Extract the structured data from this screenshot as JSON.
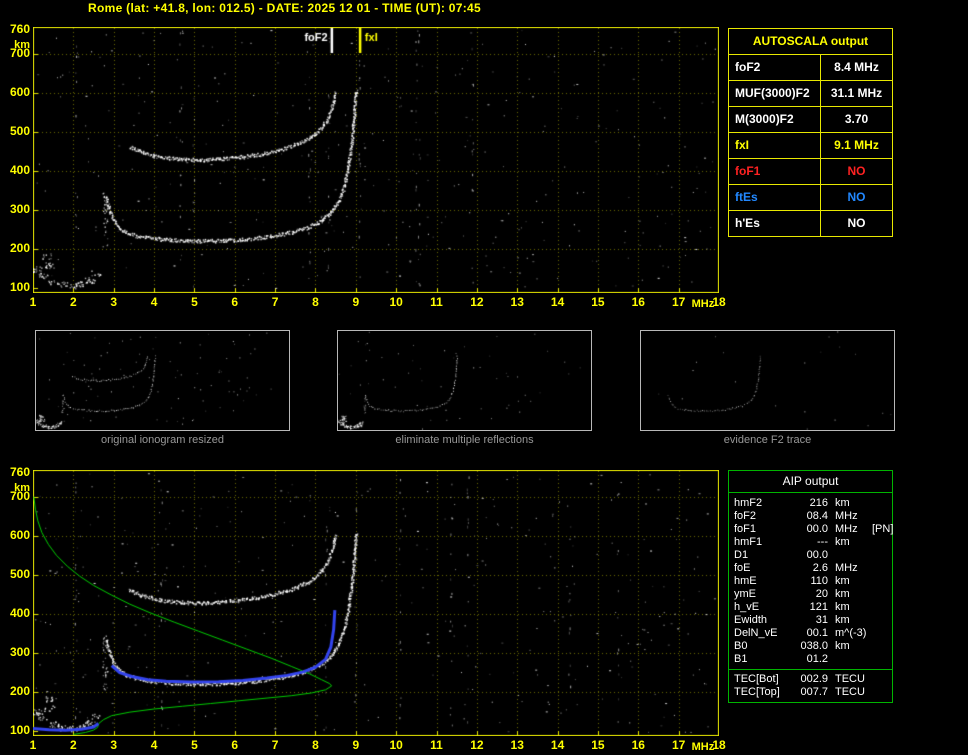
{
  "title": "Rome (lat: +41.8, lon: 012.5) - DATE: 2025 12 01 - TIME (UT): 07:45",
  "colors": {
    "background": "#000000",
    "axis_yellow": "#ffff00",
    "plot_border": "#e8e800",
    "grid": "#6a6a00",
    "echo_white": "#ffffff",
    "profile_green": "#00cc00",
    "restored_trace_blue": "#3344ee",
    "no_foF1_red": "#ff2222",
    "no_ftEs_blue": "#2288ff",
    "caption_gray": "#989898",
    "aip_border_green": "#00b400"
  },
  "autoscala": {
    "title": "AUTOSCALA output",
    "rows": [
      {
        "label": "foF2",
        "value": "8.4 MHz",
        "color": "#ffffff"
      },
      {
        "label": "MUF(3000)F2",
        "value": "31.1 MHz",
        "color": "#ffffff"
      },
      {
        "label": "M(3000)F2",
        "value": "3.70",
        "color": "#ffffff"
      },
      {
        "label": "fxI",
        "value": "9.1 MHz",
        "color": "#ffff00"
      },
      {
        "label": "foF1",
        "value": "NO",
        "color": "#ff2222"
      },
      {
        "label": "ftEs",
        "value": "NO",
        "color": "#2288ff"
      },
      {
        "label": "h'Es",
        "value": "NO",
        "color": "#ffffff"
      }
    ]
  },
  "aip": {
    "title": "AIP output",
    "rows": [
      {
        "name": "hmF2",
        "value": "216",
        "unit": "km",
        "note": ""
      },
      {
        "name": "foF2",
        "value": "08.4",
        "unit": "MHz",
        "note": ""
      },
      {
        "name": "foF1",
        "value": "00.0",
        "unit": "MHz",
        "note": "[PN]"
      },
      {
        "name": "hmF1",
        "value": "---",
        "unit": "km",
        "note": ""
      },
      {
        "name": "D1",
        "value": "00.0",
        "unit": "",
        "note": ""
      },
      {
        "name": "foE",
        "value": "2.6",
        "unit": "MHz",
        "note": ""
      },
      {
        "name": "hmE",
        "value": "110",
        "unit": "km",
        "note": ""
      },
      {
        "name": "ymE",
        "value": "20",
        "unit": "km",
        "note": ""
      },
      {
        "name": "h_vE",
        "value": "121",
        "unit": "km",
        "note": ""
      },
      {
        "name": "Ewidth",
        "value": "31",
        "unit": "km",
        "note": ""
      },
      {
        "name": "DelN_vE",
        "value": "00.1",
        "unit": "m^(-3)",
        "note": ""
      },
      {
        "name": "B0",
        "value": "038.0",
        "unit": "km",
        "note": ""
      },
      {
        "name": "B1",
        "value": "01.2",
        "unit": "",
        "note": ""
      }
    ],
    "tec_rows": [
      {
        "name": "TEC[Bot]",
        "value": "002.9",
        "unit": "TECU",
        "note": ""
      },
      {
        "name": "TEC[Top]",
        "value": "007.7",
        "unit": "TECU",
        "note": ""
      }
    ]
  },
  "thumbnails": [
    {
      "caption": "original ionogram resized",
      "traces": [
        "E-region-echoes",
        "F2-leading-edge-spread",
        "F2-first-hop",
        "F2-second-hop"
      ],
      "noise": 90,
      "seed": 21,
      "alpha": 1
    },
    {
      "caption": "eliminate multiple reflections",
      "traces": [
        "E-region-echoes",
        "F2-leading-edge-spread",
        "F2-first-hop"
      ],
      "noise": 55,
      "seed": 22,
      "alpha": 0.95
    },
    {
      "caption": "evidence F2 trace",
      "traces": [
        "F2-first-hop"
      ],
      "noise": 20,
      "seed": 23,
      "alpha": 0.75
    }
  ],
  "chart_data": [
    {
      "id": "main-ionogram",
      "type": "scatter",
      "title": "measured ionogram with AUTOSCALA scaling",
      "xlabel": "MHz",
      "ylabel": "km",
      "xlim": [
        1,
        18
      ],
      "ylim": [
        100,
        760
      ],
      "xticks": [
        1,
        2,
        3,
        4,
        5,
        6,
        7,
        8,
        9,
        10,
        11,
        12,
        13,
        14,
        15,
        16,
        17,
        18
      ],
      "yticks": [
        760,
        700,
        600,
        500,
        400,
        300,
        200,
        100
      ],
      "grid": true,
      "legend_position": "none",
      "markers": [
        {
          "label": "foF2",
          "freq": 8.4,
          "color": "#ffffff",
          "label_side": "left"
        },
        {
          "label": "fxI",
          "freq": 9.1,
          "color": "#ffff00",
          "label_side": "right"
        }
      ],
      "traces": [
        {
          "name": "E-region-echoes",
          "color": "#ffffff",
          "style": "blob",
          "points": [
            [
              1.1,
              150
            ],
            [
              1.25,
              132
            ],
            [
              1.4,
              160
            ],
            [
              1.5,
              118
            ],
            [
              1.7,
              110
            ],
            [
              1.95,
              108
            ],
            [
              2.2,
              112
            ],
            [
              2.4,
              122
            ],
            [
              2.55,
              140
            ],
            [
              1.35,
              183
            ]
          ]
        },
        {
          "name": "F2-leading-edge-spread",
          "color": "#ffffff",
          "style": "column",
          "points": [
            [
              2.78,
              205
            ],
            [
              2.78,
              345
            ]
          ]
        },
        {
          "name": "F2-first-hop",
          "color": "#ffffff",
          "style": "band",
          "points": [
            [
              2.8,
              330
            ],
            [
              2.95,
              285
            ],
            [
              3.1,
              258
            ],
            [
              3.3,
              244
            ],
            [
              3.6,
              234
            ],
            [
              4.0,
              228
            ],
            [
              4.5,
              224
            ],
            [
              5.0,
              222
            ],
            [
              5.5,
              222
            ],
            [
              6.0,
              224
            ],
            [
              6.5,
              229
            ],
            [
              7.0,
              236
            ],
            [
              7.4,
              244
            ],
            [
              7.8,
              256
            ],
            [
              8.1,
              271
            ],
            [
              8.35,
              292
            ],
            [
              8.55,
              320
            ],
            [
              8.7,
              358
            ],
            [
              8.8,
              410
            ],
            [
              8.9,
              480
            ],
            [
              8.95,
              545
            ],
            [
              9.0,
              610
            ]
          ]
        },
        {
          "name": "F2-second-hop",
          "color": "#ffffff",
          "style": "band",
          "points": [
            [
              3.4,
              462
            ],
            [
              3.7,
              448
            ],
            [
              4.1,
              437
            ],
            [
              4.6,
              431
            ],
            [
              5.1,
              429
            ],
            [
              5.6,
              431
            ],
            [
              6.1,
              436
            ],
            [
              6.6,
              443
            ],
            [
              7.0,
              452
            ],
            [
              7.4,
              464
            ],
            [
              7.8,
              482
            ],
            [
              8.1,
              505
            ],
            [
              8.3,
              535
            ],
            [
              8.42,
              570
            ],
            [
              8.5,
              605
            ]
          ]
        }
      ],
      "noise": {
        "count": 340,
        "seed": 7
      }
    },
    {
      "id": "profile-ionogram",
      "type": "scatter",
      "title": "ionogram with restored trace and electron density profile",
      "xlabel": "MHz",
      "ylabel": "km",
      "xlim": [
        1,
        18
      ],
      "ylim": [
        100,
        760
      ],
      "xticks": [
        1,
        2,
        3,
        4,
        5,
        6,
        7,
        8,
        9,
        10,
        11,
        12,
        13,
        14,
        15,
        16,
        17,
        18
      ],
      "yticks": [
        760,
        700,
        600,
        500,
        400,
        300,
        200,
        100
      ],
      "grid": true,
      "legend_position": "none",
      "traces_ref": 0,
      "overlays": [
        {
          "name": "electron-density-profile-topside",
          "color": "#00cc00",
          "width": 1,
          "points": [
            [
              1.02,
              700
            ],
            [
              1.06,
              668
            ],
            [
              1.12,
              638
            ],
            [
              1.22,
              608
            ],
            [
              1.38,
              578
            ],
            [
              1.58,
              550
            ],
            [
              1.85,
              522
            ],
            [
              2.15,
              497
            ],
            [
              2.5,
              473
            ],
            [
              2.95,
              448
            ],
            [
              3.4,
              425
            ],
            [
              3.9,
              403
            ],
            [
              4.5,
              379
            ],
            [
              5.1,
              356
            ],
            [
              5.7,
              333
            ],
            [
              6.3,
              310
            ],
            [
              6.9,
              287
            ],
            [
              7.4,
              266
            ],
            [
              7.85,
              247
            ],
            [
              8.15,
              232
            ],
            [
              8.35,
              222
            ],
            [
              8.4,
              216
            ]
          ]
        },
        {
          "name": "electron-density-profile-bottomside",
          "color": "#00cc00",
          "width": 1,
          "points": [
            [
              8.4,
              216
            ],
            [
              8.25,
              206
            ],
            [
              7.9,
              198
            ],
            [
              7.4,
              191
            ],
            [
              6.8,
              185
            ],
            [
              6.1,
              178
            ],
            [
              5.4,
              171
            ],
            [
              4.7,
              164
            ],
            [
              4.0,
              157
            ],
            [
              3.4,
              149
            ],
            [
              2.95,
              140
            ],
            [
              2.75,
              130
            ],
            [
              2.63,
              120
            ],
            [
              2.6,
              110
            ],
            [
              2.5,
              103
            ],
            [
              2.3,
              97
            ],
            [
              2.0,
              92
            ]
          ]
        },
        {
          "name": "restored-trace-F",
          "color": "#3344ee",
          "width": 3,
          "points": [
            [
              2.95,
              268
            ],
            [
              3.15,
              250
            ],
            [
              3.45,
              240
            ],
            [
              3.85,
              232
            ],
            [
              4.3,
              228
            ],
            [
              4.9,
              226
            ],
            [
              5.6,
              227
            ],
            [
              6.2,
              230
            ],
            [
              6.8,
              236
            ],
            [
              7.3,
              243
            ],
            [
              7.7,
              252
            ],
            [
              8.0,
              264
            ],
            [
              8.25,
              284
            ],
            [
              8.38,
              315
            ],
            [
              8.45,
              360
            ],
            [
              8.48,
              410
            ]
          ]
        },
        {
          "name": "restored-trace-E",
          "color": "#3344ee",
          "width": 3,
          "points": [
            [
              1.0,
              107
            ],
            [
              1.4,
              104
            ],
            [
              1.8,
              103
            ],
            [
              2.2,
              105
            ],
            [
              2.5,
              111
            ],
            [
              2.62,
              120
            ]
          ]
        }
      ],
      "noise": {
        "count": 340,
        "seed": 13
      }
    }
  ]
}
